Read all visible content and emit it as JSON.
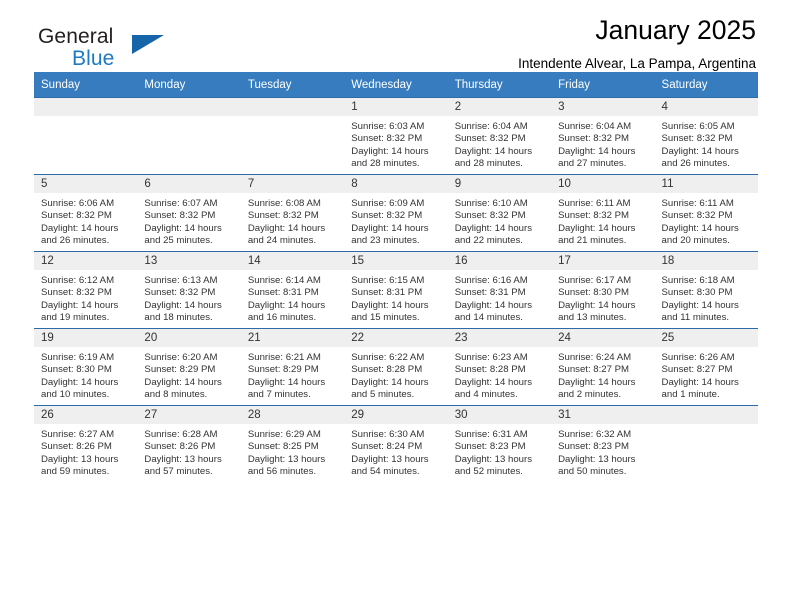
{
  "brand": {
    "word1": "General",
    "word2": "Blue",
    "triangle_color": "#1665ab",
    "blue_color": "#1d7ac4"
  },
  "header": {
    "title": "January 2025",
    "subtitle": "Intendente Alvear, La Pampa, Argentina"
  },
  "theme": {
    "header_bg": "#367cbf",
    "daynum_bg": "#efefef",
    "grid_line": "#2b6ca8",
    "text": "#333333"
  },
  "weekdays": [
    "Sunday",
    "Monday",
    "Tuesday",
    "Wednesday",
    "Thursday",
    "Friday",
    "Saturday"
  ],
  "weeks": [
    [
      {
        "day": "",
        "lines": []
      },
      {
        "day": "",
        "lines": []
      },
      {
        "day": "",
        "lines": []
      },
      {
        "day": "1",
        "lines": [
          "Sunrise: 6:03 AM",
          "Sunset: 8:32 PM",
          "Daylight: 14 hours",
          "and 28 minutes."
        ]
      },
      {
        "day": "2",
        "lines": [
          "Sunrise: 6:04 AM",
          "Sunset: 8:32 PM",
          "Daylight: 14 hours",
          "and 28 minutes."
        ]
      },
      {
        "day": "3",
        "lines": [
          "Sunrise: 6:04 AM",
          "Sunset: 8:32 PM",
          "Daylight: 14 hours",
          "and 27 minutes."
        ]
      },
      {
        "day": "4",
        "lines": [
          "Sunrise: 6:05 AM",
          "Sunset: 8:32 PM",
          "Daylight: 14 hours",
          "and 26 minutes."
        ]
      }
    ],
    [
      {
        "day": "5",
        "lines": [
          "Sunrise: 6:06 AM",
          "Sunset: 8:32 PM",
          "Daylight: 14 hours",
          "and 26 minutes."
        ]
      },
      {
        "day": "6",
        "lines": [
          "Sunrise: 6:07 AM",
          "Sunset: 8:32 PM",
          "Daylight: 14 hours",
          "and 25 minutes."
        ]
      },
      {
        "day": "7",
        "lines": [
          "Sunrise: 6:08 AM",
          "Sunset: 8:32 PM",
          "Daylight: 14 hours",
          "and 24 minutes."
        ]
      },
      {
        "day": "8",
        "lines": [
          "Sunrise: 6:09 AM",
          "Sunset: 8:32 PM",
          "Daylight: 14 hours",
          "and 23 minutes."
        ]
      },
      {
        "day": "9",
        "lines": [
          "Sunrise: 6:10 AM",
          "Sunset: 8:32 PM",
          "Daylight: 14 hours",
          "and 22 minutes."
        ]
      },
      {
        "day": "10",
        "lines": [
          "Sunrise: 6:11 AM",
          "Sunset: 8:32 PM",
          "Daylight: 14 hours",
          "and 21 minutes."
        ]
      },
      {
        "day": "11",
        "lines": [
          "Sunrise: 6:11 AM",
          "Sunset: 8:32 PM",
          "Daylight: 14 hours",
          "and 20 minutes."
        ]
      }
    ],
    [
      {
        "day": "12",
        "lines": [
          "Sunrise: 6:12 AM",
          "Sunset: 8:32 PM",
          "Daylight: 14 hours",
          "and 19 minutes."
        ]
      },
      {
        "day": "13",
        "lines": [
          "Sunrise: 6:13 AM",
          "Sunset: 8:32 PM",
          "Daylight: 14 hours",
          "and 18 minutes."
        ]
      },
      {
        "day": "14",
        "lines": [
          "Sunrise: 6:14 AM",
          "Sunset: 8:31 PM",
          "Daylight: 14 hours",
          "and 16 minutes."
        ]
      },
      {
        "day": "15",
        "lines": [
          "Sunrise: 6:15 AM",
          "Sunset: 8:31 PM",
          "Daylight: 14 hours",
          "and 15 minutes."
        ]
      },
      {
        "day": "16",
        "lines": [
          "Sunrise: 6:16 AM",
          "Sunset: 8:31 PM",
          "Daylight: 14 hours",
          "and 14 minutes."
        ]
      },
      {
        "day": "17",
        "lines": [
          "Sunrise: 6:17 AM",
          "Sunset: 8:30 PM",
          "Daylight: 14 hours",
          "and 13 minutes."
        ]
      },
      {
        "day": "18",
        "lines": [
          "Sunrise: 6:18 AM",
          "Sunset: 8:30 PM",
          "Daylight: 14 hours",
          "and 11 minutes."
        ]
      }
    ],
    [
      {
        "day": "19",
        "lines": [
          "Sunrise: 6:19 AM",
          "Sunset: 8:30 PM",
          "Daylight: 14 hours",
          "and 10 minutes."
        ]
      },
      {
        "day": "20",
        "lines": [
          "Sunrise: 6:20 AM",
          "Sunset: 8:29 PM",
          "Daylight: 14 hours",
          "and 8 minutes."
        ]
      },
      {
        "day": "21",
        "lines": [
          "Sunrise: 6:21 AM",
          "Sunset: 8:29 PM",
          "Daylight: 14 hours",
          "and 7 minutes."
        ]
      },
      {
        "day": "22",
        "lines": [
          "Sunrise: 6:22 AM",
          "Sunset: 8:28 PM",
          "Daylight: 14 hours",
          "and 5 minutes."
        ]
      },
      {
        "day": "23",
        "lines": [
          "Sunrise: 6:23 AM",
          "Sunset: 8:28 PM",
          "Daylight: 14 hours",
          "and 4 minutes."
        ]
      },
      {
        "day": "24",
        "lines": [
          "Sunrise: 6:24 AM",
          "Sunset: 8:27 PM",
          "Daylight: 14 hours",
          "and 2 minutes."
        ]
      },
      {
        "day": "25",
        "lines": [
          "Sunrise: 6:26 AM",
          "Sunset: 8:27 PM",
          "Daylight: 14 hours",
          "and 1 minute."
        ]
      }
    ],
    [
      {
        "day": "26",
        "lines": [
          "Sunrise: 6:27 AM",
          "Sunset: 8:26 PM",
          "Daylight: 13 hours",
          "and 59 minutes."
        ]
      },
      {
        "day": "27",
        "lines": [
          "Sunrise: 6:28 AM",
          "Sunset: 8:26 PM",
          "Daylight: 13 hours",
          "and 57 minutes."
        ]
      },
      {
        "day": "28",
        "lines": [
          "Sunrise: 6:29 AM",
          "Sunset: 8:25 PM",
          "Daylight: 13 hours",
          "and 56 minutes."
        ]
      },
      {
        "day": "29",
        "lines": [
          "Sunrise: 6:30 AM",
          "Sunset: 8:24 PM",
          "Daylight: 13 hours",
          "and 54 minutes."
        ]
      },
      {
        "day": "30",
        "lines": [
          "Sunrise: 6:31 AM",
          "Sunset: 8:23 PM",
          "Daylight: 13 hours",
          "and 52 minutes."
        ]
      },
      {
        "day": "31",
        "lines": [
          "Sunrise: 6:32 AM",
          "Sunset: 8:23 PM",
          "Daylight: 13 hours",
          "and 50 minutes."
        ]
      },
      {
        "day": "",
        "lines": []
      }
    ]
  ]
}
